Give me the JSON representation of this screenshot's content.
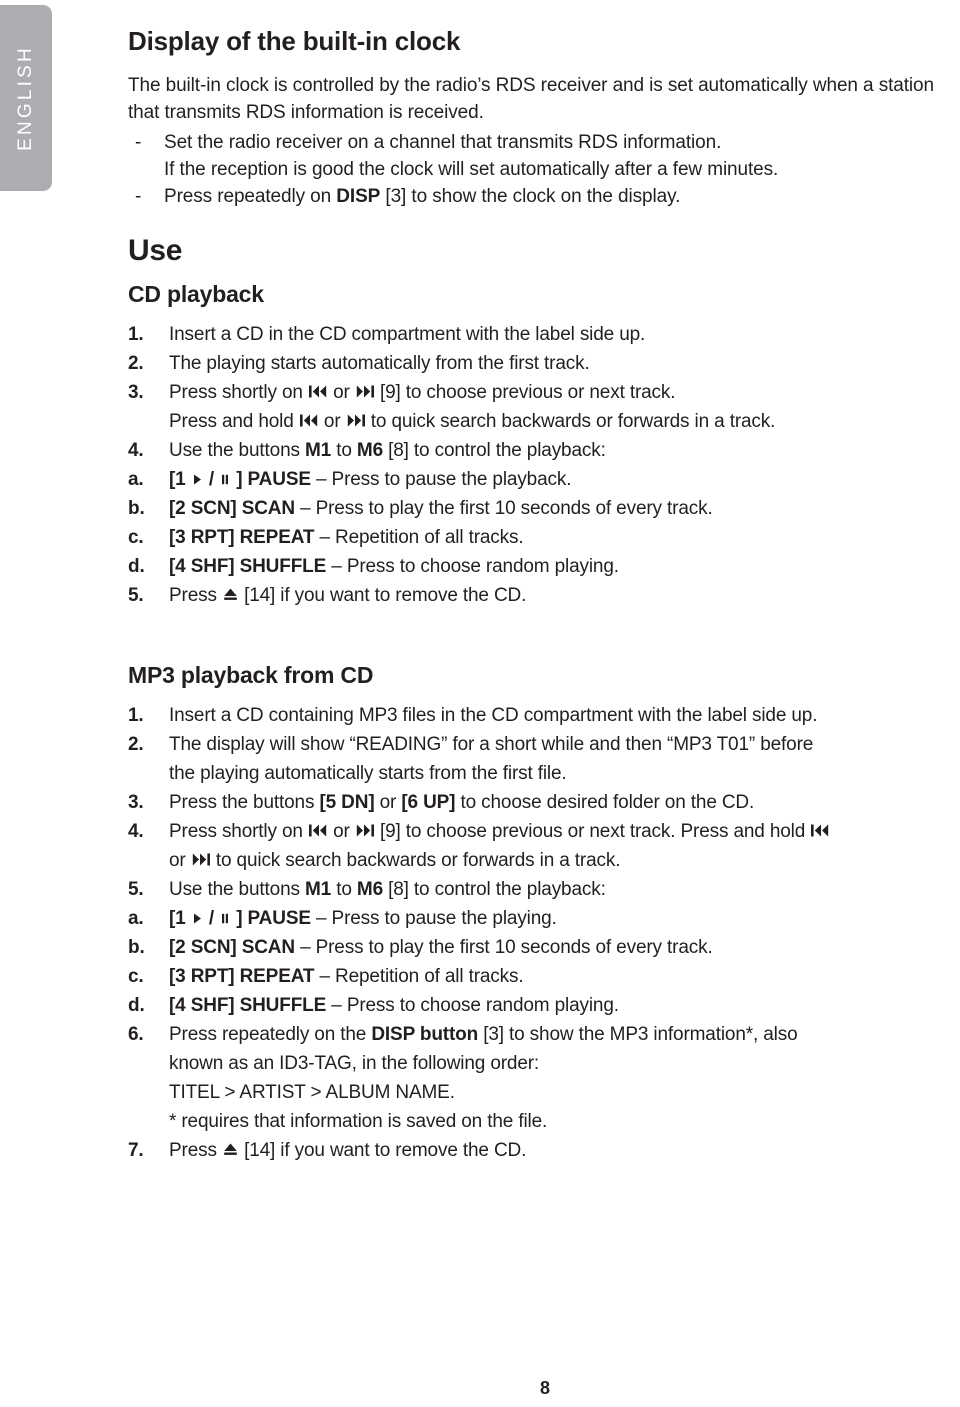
{
  "sidebar": {
    "language_tab": "ENGLISH"
  },
  "page": {
    "number": "8"
  },
  "section_clock": {
    "title": "Display of the built-in clock",
    "intro": "The built-in clock is controlled by the radio’s RDS receiver and is set automatically when a station that transmits RDS information is received.",
    "dash_marker": "-",
    "bullets": [
      {
        "line1": "Set the radio receiver on a channel that transmits RDS information.",
        "line2": "If the reception is good the clock will set automatically after a few minutes."
      },
      {
        "pre": "Press repeatedly on ",
        "bold": "DISP",
        "post": " [3] to show the clock on the display."
      }
    ]
  },
  "section_use": {
    "title": "Use"
  },
  "section_cd": {
    "title": "CD playback",
    "items": [
      {
        "marker": "1.",
        "text": "Insert a CD in the CD compartment with the label side up."
      },
      {
        "marker": "2.",
        "text": "The playing starts automatically from the first track."
      },
      {
        "marker": "3.",
        "l1_pre": "Press shortly on ",
        "l1_mid": " or ",
        "l1_post": " [9] to choose previous or next track.",
        "l2_pre": "Press and hold ",
        "l2_mid": " or ",
        "l2_post": " to quick search backwards or forwards in a track."
      },
      {
        "marker": "4.",
        "pre": "Use the buttons ",
        "b1": "M1",
        "mid": " to ",
        "b2": "M6",
        "post": " [8] to control the playback:"
      },
      {
        "marker": "a.",
        "code_pre": "[1 ",
        "code_mid": " / ",
        "code_post": " ] PAUSE",
        "desc": " – Press to pause the playback."
      },
      {
        "marker": "b.",
        "code": "[2 SCN] SCAN",
        "desc": " – Press to play the first 10 seconds of every track."
      },
      {
        "marker": "c.",
        "code": "[3 RPT] REPEAT",
        "desc": " – Repetition of all tracks."
      },
      {
        "marker": "d.",
        "code": "[4 SHF] SHUFFLE",
        "desc": " – Press to choose random playing."
      },
      {
        "marker": "5.",
        "pre": "Press ",
        "post": " [14] if you want to remove the CD."
      }
    ]
  },
  "section_mp3": {
    "title": "MP3 playback from CD",
    "items": [
      {
        "marker": "1.",
        "text": "Insert a CD containing MP3 files in the CD compartment with the label side up."
      },
      {
        "marker": "2.",
        "line1": "The display will show “READING” for a short while and then “MP3 T01” before",
        "line2": "the playing automatically starts from the first file."
      },
      {
        "marker": "3.",
        "pre": "Press the buttons ",
        "b1": "[5 DN]",
        "mid": " or ",
        "b2": "[6 UP]",
        "post": " to choose desired folder on the CD."
      },
      {
        "marker": "4.",
        "l1_pre": "Press shortly on ",
        "l1_mid": " or ",
        "l1_post": " [9] to choose previous or next track. Press and hold ",
        "l2_pre": "or ",
        "l2_post": " to quick search backwards or forwards in a track."
      },
      {
        "marker": "5.",
        "pre": "Use the buttons ",
        "b1": "M1",
        "mid": " to ",
        "b2": "M6",
        "post": " [8] to control the playback:"
      },
      {
        "marker": "a.",
        "code_pre": "[1 ",
        "code_mid": " / ",
        "code_post": " ] PAUSE",
        "desc": " – Press to pause the playing."
      },
      {
        "marker": "b.",
        "code": "[2 SCN] SCAN",
        "desc": " – Press to play the first 10 seconds of every track."
      },
      {
        "marker": "c.",
        "code": "[3 RPT] REPEAT",
        "desc": " – Repetition of all tracks."
      },
      {
        "marker": "d.",
        "code": "[4 SHF] SHUFFLE",
        "desc": " – Press to choose random playing."
      },
      {
        "marker": "6.",
        "pre": "Press repeatedly on the ",
        "bold": "DISP button",
        "post": " [3] to show the MP3 information*, also",
        "line2": "known as an ID3-TAG, in the following order:",
        "line3": "TITEL > ARTIST > ALBUM NAME.",
        "line4": "* requires that information is saved on the file."
      },
      {
        "marker": "7.",
        "pre": "Press ",
        "post": " [14] if you want to remove the CD."
      }
    ]
  },
  "icons": {
    "skip_back": "skip-backward-icon",
    "skip_forward": "skip-forward-icon",
    "play": "play-icon",
    "pause": "pause-icon",
    "eject": "eject-icon"
  }
}
